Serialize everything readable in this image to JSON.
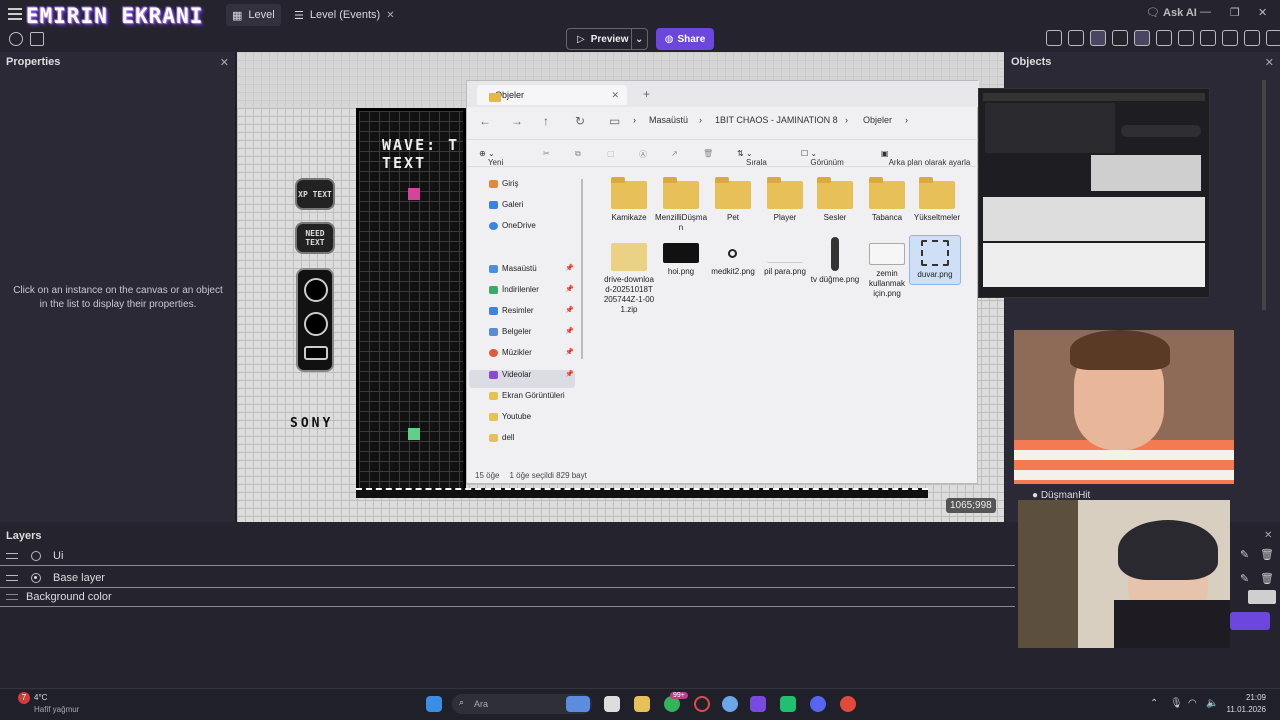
{
  "app": {
    "overlay_title": "EMIRIN EKRANI",
    "tabs": [
      {
        "label": "Level",
        "active": true
      },
      {
        "label": "Level (Events)",
        "active": false
      }
    ],
    "ask_ai": "Ask AI",
    "preview_label": "Preview",
    "share_label": "Share"
  },
  "properties": {
    "title": "Properties",
    "empty_message": "Click on an instance on the canvas or an object in the list to display their properties."
  },
  "objects": {
    "title": "Objects"
  },
  "canvas": {
    "wave_text": "WAVE: T",
    "text_label": "TEXT",
    "xp_text": "XP TEXT",
    "need_text": "NEED TEXT",
    "sony_label": "SONY",
    "coord_readout": "1065;998"
  },
  "explorer": {
    "tab_title": "Objeler",
    "breadcrumbs": [
      "Masaüstü",
      "1BIT CHAOS - JAMINATION 8",
      "Objeler"
    ],
    "commands": [
      "Yeni",
      "Sırala",
      "Görünüm",
      "Arka plan olarak ayarla"
    ],
    "sidebar": [
      {
        "label": "Giriş",
        "color": "#e08a3c"
      },
      {
        "label": "Galeri",
        "color": "#3c84e0"
      },
      {
        "label": "OneDrive",
        "color": "#3c84e0"
      },
      {
        "label": "Masaüstü",
        "color": "#4a90d9"
      },
      {
        "label": "İndirilenler",
        "color": "#3aa86b"
      },
      {
        "label": "Resimler",
        "color": "#3c84e0"
      },
      {
        "label": "Belgeler",
        "color": "#5b8bd0"
      },
      {
        "label": "Müzikler",
        "color": "#e05a3c"
      },
      {
        "label": "Videolar",
        "color": "#8a4ad8"
      },
      {
        "label": "Ekran Görüntüleri",
        "color": "#e8c058"
      },
      {
        "label": "Youtube",
        "color": "#e8c058"
      },
      {
        "label": "dell",
        "color": "#e8c058"
      }
    ],
    "files": [
      {
        "name": "Kamikaze",
        "kind": "folder"
      },
      {
        "name": "MenzilliDüşman",
        "kind": "folder"
      },
      {
        "name": "Pet",
        "kind": "folder"
      },
      {
        "name": "Player",
        "kind": "folder"
      },
      {
        "name": "Sesler",
        "kind": "folder"
      },
      {
        "name": "Tabanca",
        "kind": "folder"
      },
      {
        "name": "Yükseltmeler",
        "kind": "folder"
      },
      {
        "name": "drive-download-20251018T205744Z-1-001.zip",
        "kind": "zip"
      },
      {
        "name": "hoi.png",
        "kind": "image"
      },
      {
        "name": "medkit2.png",
        "kind": "image"
      },
      {
        "name": "pil para.png",
        "kind": "image"
      },
      {
        "name": "tv düğme.png",
        "kind": "image"
      },
      {
        "name": "zemin kullanmak için.png",
        "kind": "image"
      },
      {
        "name": "duvar.png",
        "kind": "image",
        "selected": true
      }
    ],
    "status_count": "15 öğe",
    "status_selected": "1 öğe seçildi  829 bayt"
  },
  "stream": {
    "second_cam_label": "DüşmanHit"
  },
  "layers": {
    "title": "Layers",
    "items": [
      {
        "label": "Ui"
      },
      {
        "label": "Base layer"
      },
      {
        "label": "Background color"
      }
    ]
  },
  "taskbar": {
    "weather_temp": "4°C",
    "weather_desc": "Hafif yağmur",
    "search_placeholder": "Ara",
    "time": "21:09",
    "date": "11.01.2026",
    "badge": "99+"
  }
}
